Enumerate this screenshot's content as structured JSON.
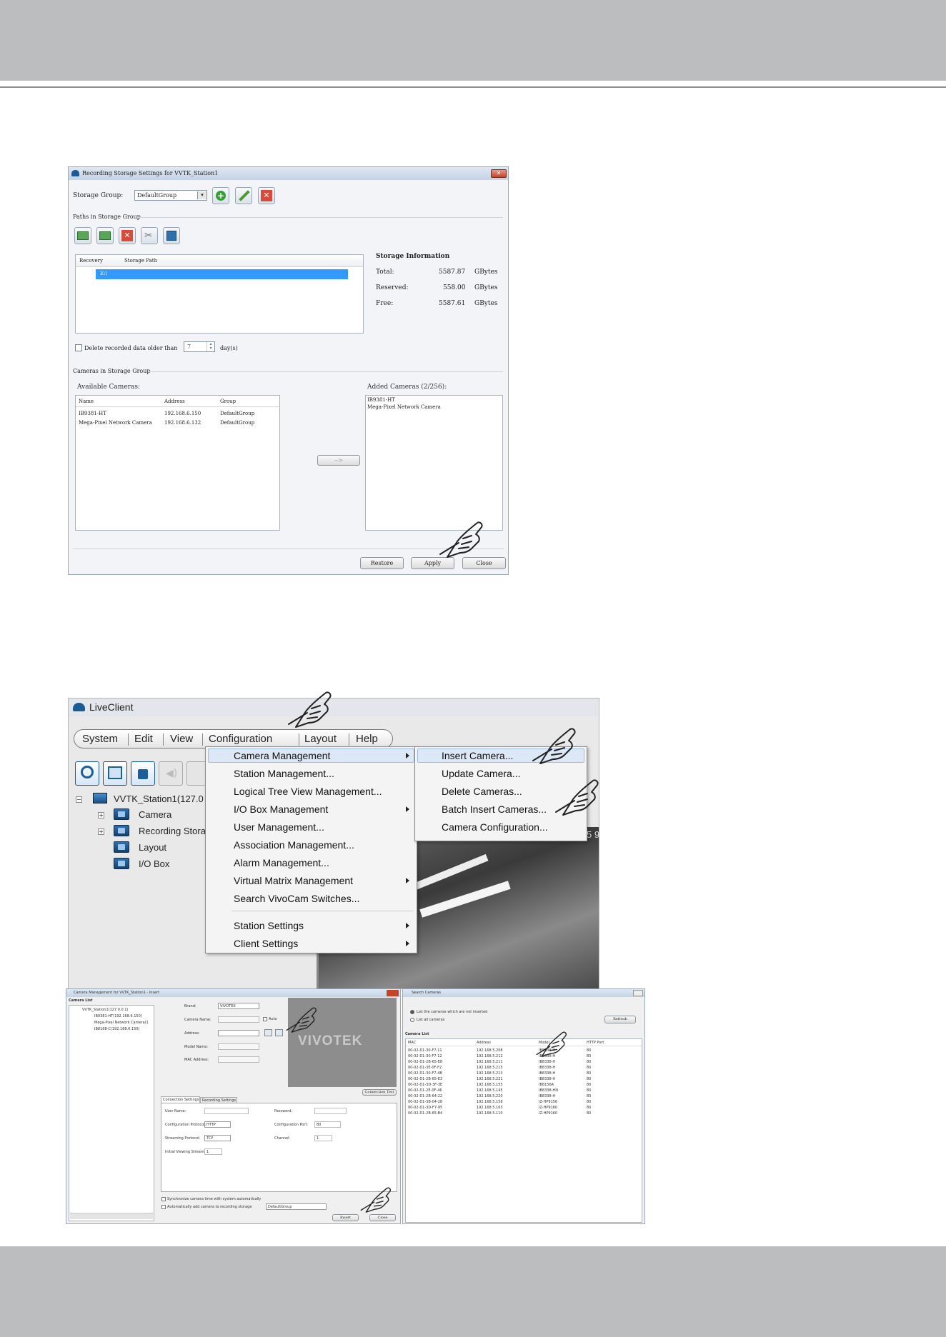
{
  "storage_dialog": {
    "title": "Recording Storage Settings for VVTK_Station1",
    "storage_group_label": "Storage Group:",
    "storage_group_value": "DefaultGroup",
    "paths_group_label": "Paths in Storage Group",
    "paths_table": {
      "headers": [
        "Recovery",
        "Storage Path"
      ],
      "rows": [
        {
          "recovery": "",
          "path": "E:\\"
        }
      ]
    },
    "storage_info": {
      "heading": "Storage Information",
      "rows": [
        {
          "label": "Total:",
          "value": "5587.87",
          "unit": "GBytes"
        },
        {
          "label": "Reserved:",
          "value": "558.00",
          "unit": "GBytes"
        },
        {
          "label": "Free:",
          "value": "5587.61",
          "unit": "GBytes"
        }
      ]
    },
    "delete_label": "Delete recorded data older than",
    "delete_days_value": "7",
    "delete_days_unit": "day(s)",
    "cameras_group_label": "Cameras in Storage Group",
    "available_label": "Available Cameras:",
    "available_headers": [
      "Name",
      "Address",
      "Group"
    ],
    "available_rows": [
      {
        "name": "IB9381-HT",
        "address": "192.168.6.150",
        "group": "DefaultGroup"
      },
      {
        "name": "Mega-Pixel Network Camera",
        "address": "192.168.6.132",
        "group": "DefaultGroup"
      }
    ],
    "move_button": "-->",
    "added_label": "Added Cameras (2/256):",
    "added_rows": [
      "IB9381-HT",
      "Mega-Pixel Network Camera"
    ],
    "buttons": {
      "restore": "Restore",
      "apply": "Apply",
      "close": "Close"
    }
  },
  "liveclient": {
    "title": "LiveClient",
    "menubar": [
      "System",
      "Edit",
      "View",
      "Configuration",
      "Layout",
      "Help"
    ],
    "config_menu": [
      {
        "label": "Camera Management",
        "submenu": true
      },
      {
        "label": "Station Management...",
        "submenu": false
      },
      {
        "label": "Logical Tree View Management...",
        "submenu": false
      },
      {
        "label": "I/O Box Management",
        "submenu": true
      },
      {
        "label": "User Management...",
        "submenu": false
      },
      {
        "label": "Association Management...",
        "submenu": false
      },
      {
        "label": "Alarm Management...",
        "submenu": false
      },
      {
        "label": "Virtual Matrix Management",
        "submenu": true
      },
      {
        "label": "Search VivoCam Switches...",
        "submenu": false
      },
      {
        "label": "Station Settings",
        "submenu": true
      },
      {
        "label": "Client Settings",
        "submenu": true
      }
    ],
    "camera_submenu": [
      "Insert Camera...",
      "Update Camera...",
      "Delete Cameras...",
      "Batch Insert Cameras...",
      "Camera Configuration..."
    ],
    "tree": {
      "root": "VVTK_Station1(127.0",
      "items": [
        "Camera",
        "Recording Stora",
        "Layout",
        "I/O Box"
      ]
    },
    "video_overlay_text": "5 9"
  },
  "camera_mgmt": {
    "title": "Camera Management for VVTK_Station1 - Insert",
    "camera_list_label": "Camera List",
    "tree_root": "VVTK_Station1(127.0.0.1)",
    "tree_items": [
      "IB9381-HT(192.168.6.150)",
      "Mega-Pixel Network Camera(1",
      "IB8168-C(192.168.6.150)"
    ],
    "fields": [
      "Brand:",
      "Camera Name:",
      "Address:",
      "Model Name:",
      "MAC Address:"
    ],
    "brand_value": "VIVOTEK",
    "auto_label": "Auto",
    "logo_text": "VIVOTEK",
    "connection_test": "Connection Test",
    "tabs": [
      "Connection Settings",
      "Recording Settings"
    ],
    "conn_fields_left": [
      "User Name:",
      "Configuration Protocol:",
      "Streaming Protocol:",
      "Initial Viewing Stream:"
    ],
    "conn_values_left": [
      "",
      "HTTP",
      "TCP",
      "1"
    ],
    "conn_fields_right": [
      "Password:",
      "Configuration Port:",
      "Channel:"
    ],
    "conn_values_right": [
      "",
      "80",
      "1"
    ],
    "check1": "Synchronize camera time with system automatically",
    "check2": "Automatically add camera to recording storage",
    "storage_value": "DefaultGroup",
    "insert_button": "Insert",
    "close_button": "Close"
  },
  "search_cameras": {
    "title": "Search Cameras",
    "radio1": "List the cameras which are not inserted",
    "radio2": "List all cameras",
    "refresh": "Refresh",
    "list_label": "Camera List",
    "headers": [
      "MAC",
      "Address",
      "Model",
      "HTTP Port"
    ],
    "rows": [
      [
        "00-02-D1-30-F7-11",
        "192.168.5.208",
        "IB8338-H",
        "80"
      ],
      [
        "00-02-D1-30-F7-12",
        "192.168.5.212",
        "IB8338-H",
        "80"
      ],
      [
        "00-02-D1-2B-65-E8",
        "192.168.5.211",
        "IB8338-H",
        "80"
      ],
      [
        "00-02-D1-3E-0F-F2",
        "192.168.5.215",
        "IB8338-H",
        "80"
      ],
      [
        "00-02-D1-30-F7-4B",
        "192.168.5.213",
        "IB8338-H",
        "80"
      ],
      [
        "00-02-D1-2B-65-E3",
        "192.168.5.221",
        "IB8338-H",
        "80"
      ],
      [
        "00-02-D1-3D-3F-3E",
        "192.168.5.155",
        "IB8156A",
        "80"
      ],
      [
        "00-02-D1-2E-0F-46",
        "192.168.5.145",
        "IB8338-HN",
        "80"
      ],
      [
        "00-02-D1-2B-64-22",
        "192.168.5.220",
        "IB8338-H",
        "80"
      ],
      [
        "00-02-D1-3B-04-28",
        "192.168.5.158",
        "IZ-HP9156",
        "80"
      ],
      [
        "00-02-D1-3D-F7-95",
        "192.168.5.163",
        "IZ-HP9160",
        "80"
      ],
      [
        "00-02-D1-2B-65-B4",
        "192.168.5.110",
        "IZ-HP9160",
        "80"
      ]
    ]
  }
}
